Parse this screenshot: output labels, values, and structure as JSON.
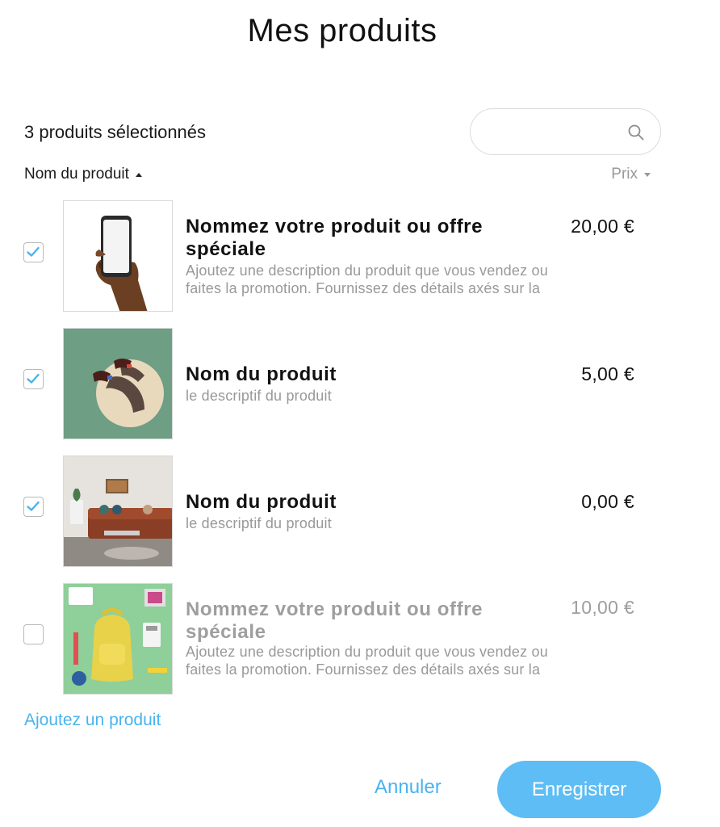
{
  "header": {
    "title": "Mes produits"
  },
  "selection": {
    "count_text": "3 produits sélectionnés"
  },
  "search": {
    "value": "",
    "placeholder": "",
    "icon": "search-icon"
  },
  "sort": {
    "name_label": "Nom du produit",
    "price_label": "Prix"
  },
  "products": [
    {
      "name_line1": "Nommez votre produit ou offre",
      "name_line2": "spéciale",
      "desc_line1": "Ajoutez une description du produit que vous vendez ou",
      "desc_line2": "faites la promotion. Fournissez des détails axés sur la",
      "price": "20,00 €",
      "checked": true,
      "image": "hand-holding-phone"
    },
    {
      "name_line1": "Nom du produit",
      "name_line2": "",
      "desc_line1": "le descriptif du produit",
      "desc_line2": "",
      "price": "5,00 €",
      "checked": true,
      "image": "legs-with-shoes"
    },
    {
      "name_line1": "Nom du produit",
      "name_line2": "",
      "desc_line1": "le descriptif du produit",
      "desc_line2": "",
      "price": "0,00 €",
      "checked": true,
      "image": "living-room"
    },
    {
      "name_line1": "Nommez votre produit ou offre",
      "name_line2": "spéciale",
      "desc_line1": "Ajoutez une description du produit que vous vendez ou",
      "desc_line2": "faites la promotion. Fournissez des détails axés sur la",
      "price": "10,00 €",
      "checked": false,
      "image": "yellow-backpack"
    }
  ],
  "actions": {
    "add_product": "Ajoutez un produit",
    "cancel": "Annuler",
    "save": "Enregistrer"
  },
  "colors": {
    "accent": "#4ab3ef",
    "save_button": "#5ebdf5",
    "muted_text": "#999999"
  }
}
